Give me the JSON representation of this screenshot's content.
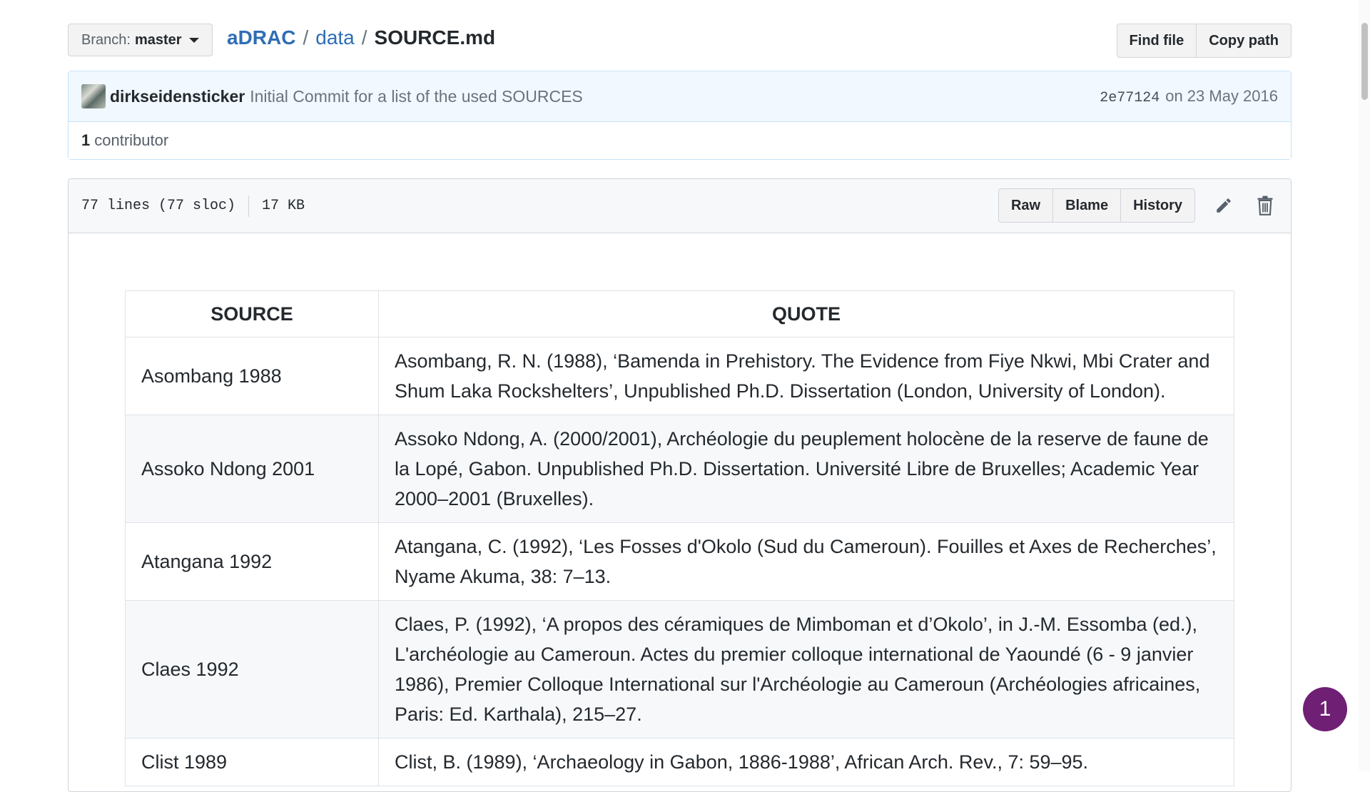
{
  "branch": {
    "prefix": "Branch:",
    "name": "master"
  },
  "breadcrumb": {
    "repo": "aDRAC",
    "separator": "/",
    "folder": "data",
    "file": "SOURCE.md"
  },
  "file_nav_buttons": {
    "find_file": "Find file",
    "copy_path": "Copy path"
  },
  "commit": {
    "author": "dirkseidensticker",
    "message": "Initial Commit for a list of the used SOURCES",
    "sha": "2e77124",
    "date_text": "on 23 May 2016"
  },
  "contributors": {
    "count": "1",
    "label": "contributor"
  },
  "file_header": {
    "lines": "77 lines (77 sloc)",
    "size": "17 KB",
    "raw": "Raw",
    "blame": "Blame",
    "history": "History"
  },
  "icons": {
    "edit": "pencil-icon",
    "delete": "trash-icon",
    "branch_menu": "caret-down-icon"
  },
  "table": {
    "headers": [
      "SOURCE",
      "QUOTE"
    ],
    "rows": [
      {
        "source": "Asombang 1988",
        "quote": "Asombang, R. N. (1988), ‘Bamenda in Prehistory. The Evidence from Fiye Nkwi, Mbi Crater and Shum Laka Rockshelters’, Unpublished Ph.D. Dissertation (London, University of London)."
      },
      {
        "source": "Assoko Ndong 2001",
        "quote": "Assoko Ndong, A. (2000/2001), Archéologie du peuplement holocène de la reserve de faune de la Lopé, Gabon. Unpublished Ph.D. Dissertation. Université Libre de Bruxelles; Academic Year 2000–2001 (Bruxelles)."
      },
      {
        "source": "Atangana 1992",
        "quote": "Atangana, C. (1992), ‘Les Fosses d'Okolo (Sud du Cameroun). Fouilles et Axes de Recherches’, Nyame Akuma, 38: 7–13."
      },
      {
        "source": "Claes 1992",
        "quote": "Claes, P. (1992), ‘A propos des céramiques de Mimboman et d’Okolo’, in J.-M. Essomba (ed.), L'archéologie au Cameroun. Actes du premier colloque international de Yaoundé (6 - 9 janvier 1986), Premier Colloque International sur l'Archéologie au Cameroun (Archéologies africaines, Paris: Ed. Karthala), 215–27."
      },
      {
        "source": "Clist 1989",
        "quote": "Clist, B. (1989), ‘Archaeology in Gabon, 1886-1988’, African Arch. Rev., 7: 59–95."
      }
    ]
  },
  "notification": {
    "count": "1"
  },
  "colors": {
    "link": "#2f6db5",
    "commit_bg": "#f1f8ff",
    "badge": "#6f1f74"
  }
}
